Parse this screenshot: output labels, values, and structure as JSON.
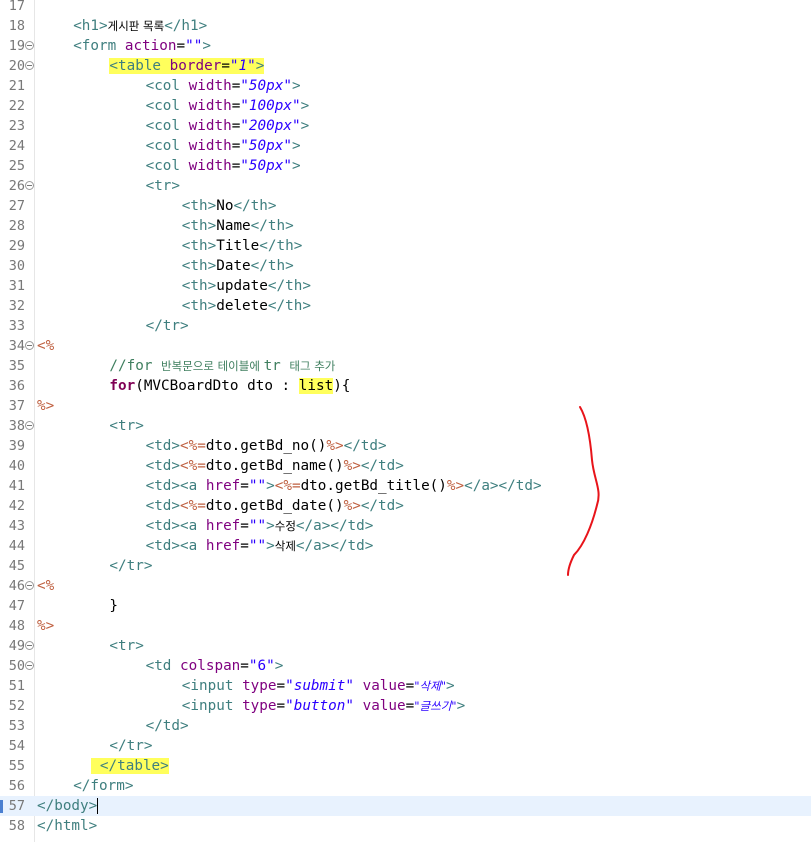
{
  "editor": {
    "lines": [
      {
        "n": "17",
        "fold": false,
        "indent": 0,
        "current": false,
        "tokens": []
      },
      {
        "n": "18",
        "fold": false,
        "indent": 2,
        "current": false,
        "tokens": [
          {
            "t": "t",
            "x": "<h1>"
          },
          {
            "t": "ko",
            "x": "게시판 목록"
          },
          {
            "t": "t",
            "x": "</h1>"
          }
        ]
      },
      {
        "n": "19",
        "fold": true,
        "indent": 2,
        "current": false,
        "tokens": [
          {
            "t": "t",
            "x": "<form "
          },
          {
            "t": "a",
            "x": "action"
          },
          {
            "t": "p",
            "x": "="
          },
          {
            "t": "vn",
            "x": "\"\""
          },
          {
            "t": "t",
            "x": ">"
          }
        ]
      },
      {
        "n": "20",
        "fold": true,
        "indent": 4,
        "current": false,
        "tokens": [
          {
            "t": "t",
            "x": "<table ",
            "h": true
          },
          {
            "t": "a",
            "x": "border",
            "h": true
          },
          {
            "t": "p",
            "x": "=",
            "h": true
          },
          {
            "t": "v",
            "x": "\"1\"",
            "h": true
          },
          {
            "t": "t",
            "x": ">",
            "h": true
          }
        ]
      },
      {
        "n": "21",
        "fold": false,
        "indent": 6,
        "current": false,
        "tokens": [
          {
            "t": "t",
            "x": "<col "
          },
          {
            "t": "a",
            "x": "width"
          },
          {
            "t": "p",
            "x": "="
          },
          {
            "t": "v",
            "x": "\"50px\""
          },
          {
            "t": "t",
            "x": ">"
          }
        ]
      },
      {
        "n": "22",
        "fold": false,
        "indent": 6,
        "current": false,
        "tokens": [
          {
            "t": "t",
            "x": "<col "
          },
          {
            "t": "a",
            "x": "width"
          },
          {
            "t": "p",
            "x": "="
          },
          {
            "t": "v",
            "x": "\"100px\""
          },
          {
            "t": "t",
            "x": ">"
          }
        ]
      },
      {
        "n": "23",
        "fold": false,
        "indent": 6,
        "current": false,
        "tokens": [
          {
            "t": "t",
            "x": "<col "
          },
          {
            "t": "a",
            "x": "width"
          },
          {
            "t": "p",
            "x": "="
          },
          {
            "t": "v",
            "x": "\"200px\""
          },
          {
            "t": "t",
            "x": ">"
          }
        ]
      },
      {
        "n": "24",
        "fold": false,
        "indent": 6,
        "current": false,
        "tokens": [
          {
            "t": "t",
            "x": "<col "
          },
          {
            "t": "a",
            "x": "width"
          },
          {
            "t": "p",
            "x": "="
          },
          {
            "t": "v",
            "x": "\"50px\""
          },
          {
            "t": "t",
            "x": ">"
          }
        ]
      },
      {
        "n": "25",
        "fold": false,
        "indent": 6,
        "current": false,
        "tokens": [
          {
            "t": "t",
            "x": "<col "
          },
          {
            "t": "a",
            "x": "width"
          },
          {
            "t": "p",
            "x": "="
          },
          {
            "t": "v",
            "x": "\"50px\""
          },
          {
            "t": "t",
            "x": ">"
          }
        ]
      },
      {
        "n": "26",
        "fold": true,
        "indent": 6,
        "current": false,
        "tokens": [
          {
            "t": "t",
            "x": "<tr>"
          }
        ]
      },
      {
        "n": "27",
        "fold": false,
        "indent": 8,
        "current": false,
        "tokens": [
          {
            "t": "t",
            "x": "<th>"
          },
          {
            "t": "p",
            "x": "No"
          },
          {
            "t": "t",
            "x": "</th>"
          }
        ]
      },
      {
        "n": "28",
        "fold": false,
        "indent": 8,
        "current": false,
        "tokens": [
          {
            "t": "t",
            "x": "<th>"
          },
          {
            "t": "p",
            "x": "Name"
          },
          {
            "t": "t",
            "x": "</th>"
          }
        ]
      },
      {
        "n": "29",
        "fold": false,
        "indent": 8,
        "current": false,
        "tokens": [
          {
            "t": "t",
            "x": "<th>"
          },
          {
            "t": "p",
            "x": "Title"
          },
          {
            "t": "t",
            "x": "</th>"
          }
        ]
      },
      {
        "n": "30",
        "fold": false,
        "indent": 8,
        "current": false,
        "tokens": [
          {
            "t": "t",
            "x": "<th>"
          },
          {
            "t": "p",
            "x": "Date"
          },
          {
            "t": "t",
            "x": "</th>"
          }
        ]
      },
      {
        "n": "31",
        "fold": false,
        "indent": 8,
        "current": false,
        "tokens": [
          {
            "t": "t",
            "x": "<th>"
          },
          {
            "t": "p",
            "x": "update"
          },
          {
            "t": "t",
            "x": "</th>"
          }
        ]
      },
      {
        "n": "32",
        "fold": false,
        "indent": 8,
        "current": false,
        "tokens": [
          {
            "t": "t",
            "x": "<th>"
          },
          {
            "t": "p",
            "x": "delete"
          },
          {
            "t": "t",
            "x": "</th>"
          }
        ]
      },
      {
        "n": "33",
        "fold": false,
        "indent": 6,
        "current": false,
        "tokens": [
          {
            "t": "t",
            "x": "</tr>"
          }
        ]
      },
      {
        "n": "34",
        "fold": true,
        "indent": 0,
        "current": false,
        "tokens": [
          {
            "t": "jsp",
            "x": "<%"
          }
        ]
      },
      {
        "n": "35",
        "fold": false,
        "indent": 4,
        "current": false,
        "tokens": [
          {
            "t": "cm",
            "x": "//for "
          },
          {
            "t": "cmko",
            "x": "반복문으로 테이블에 "
          },
          {
            "t": "cm",
            "x": "tr "
          },
          {
            "t": "cmko",
            "x": "태그 추가"
          }
        ]
      },
      {
        "n": "36",
        "fold": false,
        "indent": 4,
        "current": false,
        "tokens": [
          {
            "t": "kw",
            "x": "for"
          },
          {
            "t": "p",
            "x": "(MVCBoardDto dto : "
          },
          {
            "t": "p",
            "x": "list",
            "h": true
          },
          {
            "t": "p",
            "x": "){"
          }
        ]
      },
      {
        "n": "37",
        "fold": false,
        "indent": 0,
        "current": false,
        "tokens": [
          {
            "t": "jsp",
            "x": "%>"
          }
        ]
      },
      {
        "n": "38",
        "fold": true,
        "indent": 4,
        "current": false,
        "tokens": [
          {
            "t": "t",
            "x": "<tr>"
          }
        ]
      },
      {
        "n": "39",
        "fold": false,
        "indent": 6,
        "current": false,
        "tokens": [
          {
            "t": "t",
            "x": "<td>"
          },
          {
            "t": "jsp",
            "x": "<%="
          },
          {
            "t": "p",
            "x": "dto.getBd_no()"
          },
          {
            "t": "jsp",
            "x": "%>"
          },
          {
            "t": "t",
            "x": "</td>"
          }
        ]
      },
      {
        "n": "40",
        "fold": false,
        "indent": 6,
        "current": false,
        "tokens": [
          {
            "t": "t",
            "x": "<td>"
          },
          {
            "t": "jsp",
            "x": "<%="
          },
          {
            "t": "p",
            "x": "dto.getBd_name()"
          },
          {
            "t": "jsp",
            "x": "%>"
          },
          {
            "t": "t",
            "x": "</td>"
          }
        ]
      },
      {
        "n": "41",
        "fold": false,
        "indent": 6,
        "current": false,
        "tokens": [
          {
            "t": "t",
            "x": "<td><a "
          },
          {
            "t": "a",
            "x": "href"
          },
          {
            "t": "p",
            "x": "="
          },
          {
            "t": "vn",
            "x": "\"\""
          },
          {
            "t": "t",
            "x": ">"
          },
          {
            "t": "jsp",
            "x": "<%="
          },
          {
            "t": "p",
            "x": "dto.getBd_title()"
          },
          {
            "t": "jsp",
            "x": "%>"
          },
          {
            "t": "t",
            "x": "</a></td>"
          }
        ]
      },
      {
        "n": "42",
        "fold": false,
        "indent": 6,
        "current": false,
        "tokens": [
          {
            "t": "t",
            "x": "<td>"
          },
          {
            "t": "jsp",
            "x": "<%="
          },
          {
            "t": "p",
            "x": "dto.getBd_date()"
          },
          {
            "t": "jsp",
            "x": "%>"
          },
          {
            "t": "t",
            "x": "</td>"
          }
        ]
      },
      {
        "n": "43",
        "fold": false,
        "indent": 6,
        "current": false,
        "tokens": [
          {
            "t": "t",
            "x": "<td><a "
          },
          {
            "t": "a",
            "x": "href"
          },
          {
            "t": "p",
            "x": "="
          },
          {
            "t": "vn",
            "x": "\"\""
          },
          {
            "t": "t",
            "x": ">"
          },
          {
            "t": "ko",
            "x": "수정"
          },
          {
            "t": "t",
            "x": "</a></td>"
          }
        ]
      },
      {
        "n": "44",
        "fold": false,
        "indent": 6,
        "current": false,
        "tokens": [
          {
            "t": "t",
            "x": "<td><a "
          },
          {
            "t": "a",
            "x": "href"
          },
          {
            "t": "p",
            "x": "="
          },
          {
            "t": "vn",
            "x": "\"\""
          },
          {
            "t": "t",
            "x": ">"
          },
          {
            "t": "ko",
            "x": "삭제"
          },
          {
            "t": "t",
            "x": "</a></td>"
          }
        ]
      },
      {
        "n": "45",
        "fold": false,
        "indent": 4,
        "current": false,
        "tokens": [
          {
            "t": "t",
            "x": "</tr>"
          }
        ]
      },
      {
        "n": "46",
        "fold": true,
        "indent": 0,
        "current": false,
        "tokens": [
          {
            "t": "jsp",
            "x": "<%"
          }
        ]
      },
      {
        "n": "47",
        "fold": false,
        "indent": 4,
        "current": false,
        "tokens": [
          {
            "t": "p",
            "x": "}"
          }
        ]
      },
      {
        "n": "48",
        "fold": false,
        "indent": 0,
        "current": false,
        "tokens": [
          {
            "t": "jsp",
            "x": "%>"
          }
        ]
      },
      {
        "n": "49",
        "fold": true,
        "indent": 4,
        "current": false,
        "tokens": [
          {
            "t": "t",
            "x": "<tr>"
          }
        ]
      },
      {
        "n": "50",
        "fold": true,
        "indent": 6,
        "current": false,
        "tokens": [
          {
            "t": "t",
            "x": "<td "
          },
          {
            "t": "a",
            "x": "colspan"
          },
          {
            "t": "p",
            "x": "="
          },
          {
            "t": "vn",
            "x": "\"6\""
          },
          {
            "t": "t",
            "x": ">"
          }
        ]
      },
      {
        "n": "51",
        "fold": false,
        "indent": 8,
        "current": false,
        "tokens": [
          {
            "t": "t",
            "x": "<input "
          },
          {
            "t": "a",
            "x": "type"
          },
          {
            "t": "p",
            "x": "="
          },
          {
            "t": "v",
            "x": "\"submit\""
          },
          {
            "t": "p",
            "x": " "
          },
          {
            "t": "a",
            "x": "value"
          },
          {
            "t": "p",
            "x": "="
          },
          {
            "t": "vko",
            "x": "\"삭제\""
          },
          {
            "t": "t",
            "x": ">"
          }
        ]
      },
      {
        "n": "52",
        "fold": false,
        "indent": 8,
        "current": false,
        "tokens": [
          {
            "t": "t",
            "x": "<input "
          },
          {
            "t": "a",
            "x": "type"
          },
          {
            "t": "p",
            "x": "="
          },
          {
            "t": "v",
            "x": "\"button\""
          },
          {
            "t": "p",
            "x": " "
          },
          {
            "t": "a",
            "x": "value"
          },
          {
            "t": "p",
            "x": "="
          },
          {
            "t": "vko",
            "x": "\"글쓰기\""
          },
          {
            "t": "t",
            "x": ">"
          }
        ]
      },
      {
        "n": "53",
        "fold": false,
        "indent": 6,
        "current": false,
        "tokens": [
          {
            "t": "t",
            "x": "</td>"
          }
        ]
      },
      {
        "n": "54",
        "fold": false,
        "indent": 4,
        "current": false,
        "tokens": [
          {
            "t": "t",
            "x": "</tr>"
          }
        ]
      },
      {
        "n": "55",
        "fold": false,
        "indent": 3,
        "current": false,
        "tokens": [
          {
            "t": "p",
            "x": " ",
            "h": true
          },
          {
            "t": "t",
            "x": "</table>",
            "h": true
          }
        ]
      },
      {
        "n": "56",
        "fold": false,
        "indent": 2,
        "current": false,
        "tokens": [
          {
            "t": "t",
            "x": "</form>"
          }
        ]
      },
      {
        "n": "57",
        "fold": false,
        "indent": 0,
        "current": true,
        "marker": true,
        "tokens": [
          {
            "t": "t",
            "x": "</body>"
          }
        ],
        "caret": true
      },
      {
        "n": "58",
        "fold": false,
        "indent": 0,
        "current": false,
        "tokens": [
          {
            "t": "t",
            "x": "</html>"
          }
        ]
      }
    ]
  },
  "colors": {
    "annotation": "#e8141a",
    "highlight": "#ffff5c",
    "current_line": "#e8f2fe"
  }
}
